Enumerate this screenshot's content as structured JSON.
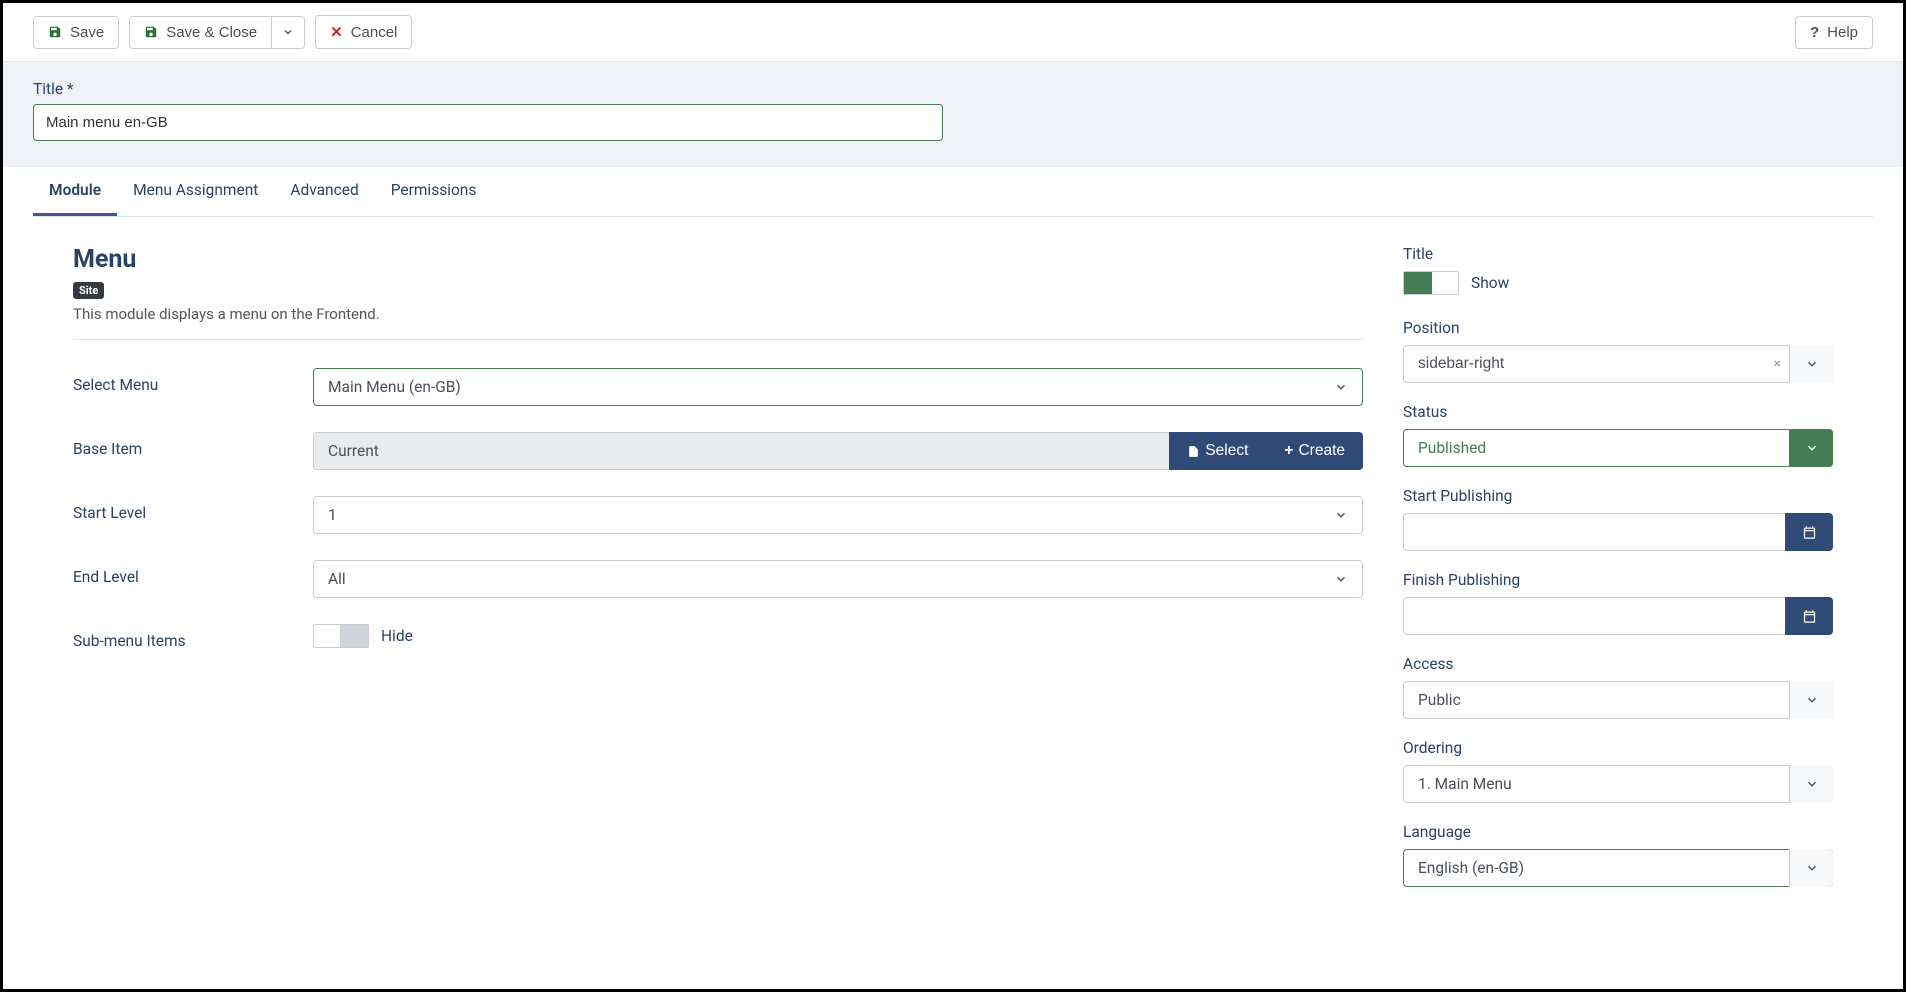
{
  "toolbar": {
    "save": "Save",
    "save_close": "Save & Close",
    "cancel": "Cancel",
    "help": "Help"
  },
  "header": {
    "title_label": "Title *",
    "title_value": "Main menu en-GB"
  },
  "tabs": {
    "module": "Module",
    "menu_assignment": "Menu Assignment",
    "advanced": "Advanced",
    "permissions": "Permissions"
  },
  "module": {
    "heading": "Menu",
    "badge": "Site",
    "description": "This module displays a menu on the Frontend.",
    "select_menu_label": "Select Menu",
    "select_menu_value": "Main Menu (en-GB)",
    "base_item_label": "Base Item",
    "base_item_value": "Current",
    "select_btn": "Select",
    "create_btn": "Create",
    "start_level_label": "Start Level",
    "start_level_value": "1",
    "end_level_label": "End Level",
    "end_level_value": "All",
    "submenu_label": "Sub-menu Items",
    "submenu_value": "Hide"
  },
  "sidebar": {
    "title_label": "Title",
    "title_toggle": "Show",
    "position_label": "Position",
    "position_value": "sidebar-right",
    "status_label": "Status",
    "status_value": "Published",
    "start_pub_label": "Start Publishing",
    "start_pub_value": "",
    "finish_pub_label": "Finish Publishing",
    "finish_pub_value": "",
    "access_label": "Access",
    "access_value": "Public",
    "ordering_label": "Ordering",
    "ordering_value": "1. Main Menu",
    "language_label": "Language",
    "language_value": "English (en-GB)"
  }
}
